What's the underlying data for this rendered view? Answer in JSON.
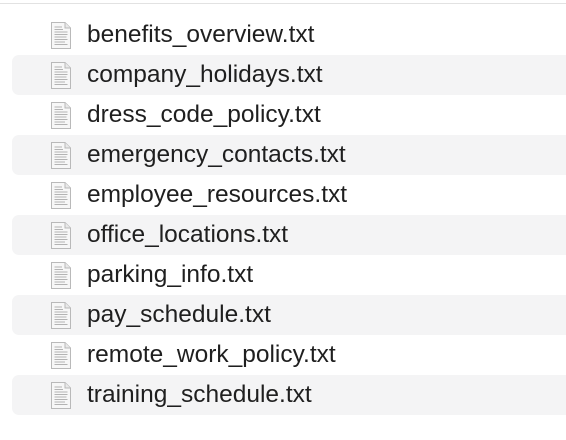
{
  "files": [
    {
      "name": "benefits_overview.txt",
      "icon": "text-document-icon"
    },
    {
      "name": "company_holidays.txt",
      "icon": "text-document-icon"
    },
    {
      "name": "dress_code_policy.txt",
      "icon": "text-document-icon"
    },
    {
      "name": "emergency_contacts.txt",
      "icon": "text-document-icon"
    },
    {
      "name": "employee_resources.txt",
      "icon": "text-document-icon"
    },
    {
      "name": "office_locations.txt",
      "icon": "text-document-icon"
    },
    {
      "name": "parking_info.txt",
      "icon": "text-document-icon"
    },
    {
      "name": "pay_schedule.txt",
      "icon": "text-document-icon"
    },
    {
      "name": "remote_work_policy.txt",
      "icon": "text-document-icon"
    },
    {
      "name": "training_schedule.txt",
      "icon": "text-document-icon"
    }
  ],
  "colors": {
    "row_stripe": "#f4f4f5",
    "text": "#1f1f1f",
    "divider": "#e2e2e2"
  }
}
